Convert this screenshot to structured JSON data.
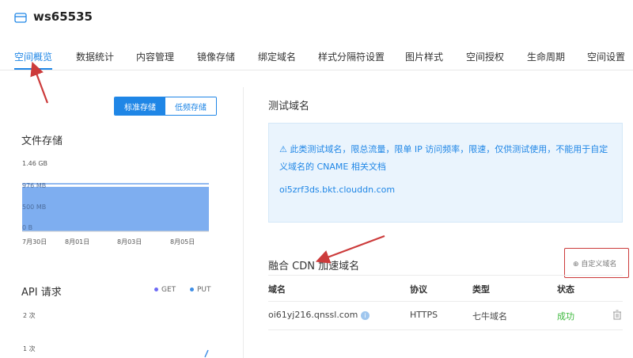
{
  "header": {
    "bucket_name": "ws65535"
  },
  "tabs": [
    {
      "label": "空间概览",
      "active": true
    },
    {
      "label": "数据统计"
    },
    {
      "label": "内容管理"
    },
    {
      "label": "镜像存储"
    },
    {
      "label": "绑定域名"
    },
    {
      "label": "样式分隔符设置"
    },
    {
      "label": "图片样式"
    },
    {
      "label": "空间授权"
    },
    {
      "label": "生命周期"
    },
    {
      "label": "空间设置"
    }
  ],
  "storage_toggle": {
    "standard": "标准存储",
    "low_freq": "低频存储",
    "selected": "标准存储"
  },
  "file_storage": {
    "title": "文件存储",
    "chart_data": {
      "type": "area",
      "x": [
        "7月30日",
        "8月01日",
        "8月03日",
        "8月05日"
      ],
      "y_ticks": [
        "1.46 GB",
        "976 MB",
        "500 MB",
        "0 B"
      ],
      "series": [
        {
          "values": [
            976,
            976,
            976,
            976,
            976,
            976,
            976,
            976,
            976
          ]
        }
      ],
      "ylim": [
        0,
        1495
      ]
    }
  },
  "api_requests": {
    "title": "API 请求",
    "legend": [
      "GET",
      "PUT"
    ],
    "chart_data": {
      "type": "line",
      "y_ticks": [
        "2 次",
        "1 次"
      ],
      "series": [
        {
          "name": "GET",
          "values": []
        },
        {
          "name": "PUT",
          "values": []
        }
      ]
    }
  },
  "test_domain": {
    "title": "测试域名",
    "notice_text": "此类测试域名，限总流量，限单 IP 访问频率，限速，仅供测试使用，不能用于自定义域名的 CNAME",
    "doc_link": "相关文档",
    "domain": "oi5zrf3ds.bkt.clouddn.com"
  },
  "cdn": {
    "title": "融合 CDN 加速域名",
    "custom_button": "自定义域名",
    "columns": [
      "域名",
      "协议",
      "类型",
      "状态"
    ],
    "rows": [
      {
        "domain": "oi61yj216.qnssl.com",
        "protocol": "HTTPS",
        "type": "七牛域名",
        "status": "成功"
      }
    ]
  },
  "colors": {
    "accent": "#1f86e6",
    "chart_fill": "#7eaef0",
    "success": "#3cb83c",
    "annotation": "#cc3b3b",
    "get": "#6d6af5",
    "put": "#3e8ee6"
  }
}
